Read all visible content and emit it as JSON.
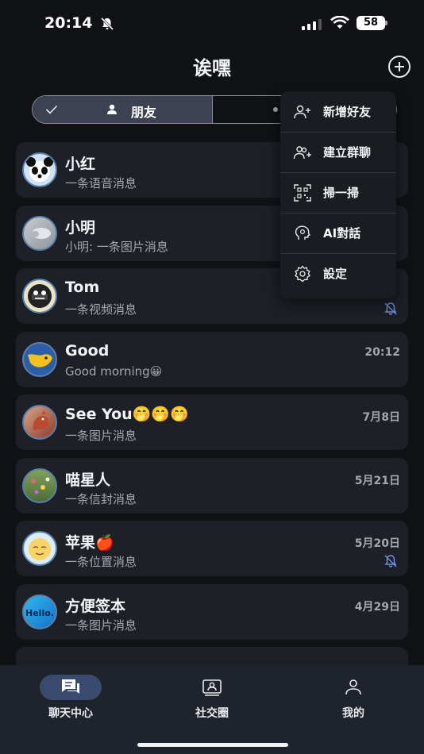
{
  "status_bar": {
    "time": "20:14",
    "battery": "58"
  },
  "header": {
    "title": "诶嘿"
  },
  "segment": {
    "left_label": "朋友"
  },
  "chats": [
    {
      "name": "小红",
      "preview": "一条语音消息",
      "time": "",
      "muted": false,
      "avatar": "panda"
    },
    {
      "name": "小明",
      "preview": "小明: 一条图片消息",
      "time": "",
      "muted": false,
      "avatar": "photo-gray"
    },
    {
      "name": "Tom",
      "preview": "一条视频消息",
      "time": "",
      "muted": true,
      "avatar": "badge-dark"
    },
    {
      "name": "Good",
      "preview": "Good morning😀",
      "time": "20:12",
      "muted": false,
      "avatar": "bird-yellow"
    },
    {
      "name": "See You🤭🤭🤭",
      "preview": "一条图片消息",
      "time": "7月8日",
      "muted": false,
      "avatar": "rooster"
    },
    {
      "name": "喵星人",
      "preview": "一条信封消息",
      "time": "5月21日",
      "muted": false,
      "avatar": "flowers"
    },
    {
      "name": "苹果🍎",
      "preview": "一条位置消息",
      "time": "5月20日",
      "muted": true,
      "avatar": "sun-face"
    },
    {
      "name": "方便签本",
      "preview": "一条图片消息",
      "time": "4月29日",
      "muted": false,
      "avatar": "hello-blue"
    }
  ],
  "menu": {
    "items": [
      {
        "label": "新增好友",
        "icon": "add-friend-icon"
      },
      {
        "label": "建立群聊",
        "icon": "create-group-icon"
      },
      {
        "label": "掃一掃",
        "icon": "scan-qr-icon"
      },
      {
        "label": "AI對話",
        "icon": "ai-chat-icon"
      },
      {
        "label": "設定",
        "icon": "settings-icon"
      }
    ]
  },
  "tabs": [
    {
      "label": "聊天中心",
      "icon": "chat-bubble-icon",
      "active": true
    },
    {
      "label": "社交圈",
      "icon": "social-circle-icon",
      "active": false
    },
    {
      "label": "我的",
      "icon": "profile-icon",
      "active": false
    }
  ],
  "colors": {
    "background": "#101216",
    "card": "#1d2027",
    "accent_tab": "#3a4a6e",
    "mute_icon": "#6f8fd8"
  }
}
